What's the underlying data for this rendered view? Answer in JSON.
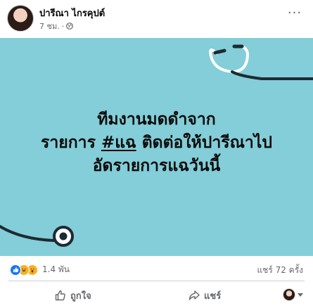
{
  "post": {
    "author": "ปารีณา ไกรคุปต์",
    "time": "7 ชม.",
    "meta_separator": "·",
    "privacy_icon": "globe-icon",
    "more_icon": "more-options-icon"
  },
  "image": {
    "background_color": "#83ced8",
    "headline_line1": "ทีมงานมดดำจาก",
    "headline_line2_prefix": "รายการ ",
    "headline_hashtag": "#แฉ",
    "headline_line2_suffix": " ติดต่อให้ปารีณาไป",
    "headline_line3": "อัดรายการแฉวันนี้"
  },
  "stats": {
    "reaction_icons": [
      "like-icon",
      "haha-icon",
      "wow-icon"
    ],
    "reaction_count": "1.4 พัน",
    "shares": "แชร์ 72 ครั้ง"
  },
  "actions": {
    "like_label": "ถูกใจ",
    "share_label": "แชร์"
  },
  "colors": {
    "like_blue": "#1877f2",
    "reaction_yellow": "#f7b125",
    "secondary_text": "#65676b"
  }
}
